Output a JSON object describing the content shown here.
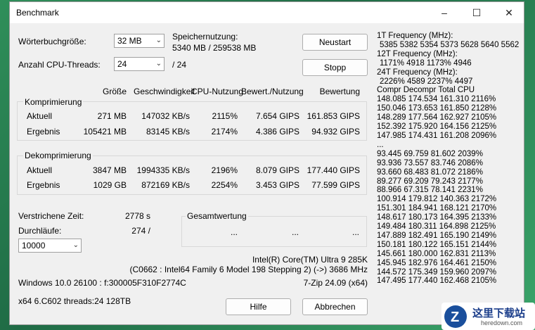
{
  "window": {
    "title": "Benchmark",
    "controls": [
      "–",
      "☐",
      "✕"
    ]
  },
  "settings": {
    "dictionary_label": "Wörterbuchgröße:",
    "dictionary_value": "32 MB",
    "threads_label": "Anzahl CPU-Threads:",
    "threads_value": "24",
    "threads_total": "/ 24",
    "memory_label": "Speichernutzung:",
    "memory_value": "5340 MB / 259538 MB"
  },
  "buttons": {
    "restart": "Neustart",
    "stop": "Stopp",
    "help": "Hilfe",
    "cancel": "Abbrechen"
  },
  "columns": [
    "Größe",
    "Geschwindigkeit",
    "CPU-Nutzung",
    "Bewert./Nutzung",
    "Bewertung"
  ],
  "compression": {
    "title": "Komprimierung",
    "rows": [
      {
        "label": "Aktuell",
        "size": "271 MB",
        "speed": "147032 KB/s",
        "cpu": "2115%",
        "rating_usage": "7.654 GIPS",
        "rating": "161.853 GIPS"
      },
      {
        "label": "Ergebnis",
        "size": "105421 MB",
        "speed": "83145 KB/s",
        "cpu": "2174%",
        "rating_usage": "4.386 GIPS",
        "rating": "94.932 GIPS"
      }
    ]
  },
  "decompression": {
    "title": "Dekomprimierung",
    "rows": [
      {
        "label": "Aktuell",
        "size": "3847 MB",
        "speed": "1994335 KB/s",
        "cpu": "2196%",
        "rating_usage": "8.079 GIPS",
        "rating": "177.440 GIPS"
      },
      {
        "label": "Ergebnis",
        "size": "1029 GB",
        "speed": "872169 KB/s",
        "cpu": "2254%",
        "rating_usage": "3.453 GIPS",
        "rating": "77.599 GIPS"
      }
    ]
  },
  "elapsed": {
    "label": "Verstrichene Zeit:",
    "value": "2778 s"
  },
  "passes": {
    "label": "Durchläufe:",
    "value": "274 /",
    "select": "10000"
  },
  "total": {
    "title": "Gesamtwertung",
    "values": [
      "...",
      "...",
      "..."
    ]
  },
  "cpu_info": {
    "name": "Intel(R) Core(TM) Ultra 9 285K",
    "detail": "(C0662 : Intel64 Family 6 Model 198 Stepping 2) (->) 3686 MHz",
    "os": "Windows 10.0 26100 : f:300005F310F2774C",
    "version": "7-Zip 24.09 (x64)",
    "arch": "x64 6.C602 threads:24 128TB"
  },
  "freq": {
    "f1_label": "1T Frequency (MHz):",
    "f1_values": "5385 5382 5354 5373 5628 5640 5562",
    "f12_label": "12T Frequency (MHz):",
    "f12_values": "1171% 4918 1173% 4946",
    "f24_label": "24T Frequency (MHz):",
    "f24_values": "2226% 4589 2237% 4497",
    "table_header": "Compr Decompr Total   CPU",
    "rows_a": [
      "148.085  174.534  161.310  2116%",
      "150.046  173.653  161.850  2128%",
      "148.289  177.564  162.927  2105%",
      "152.392  175.920  164.156  2125%",
      "147.985  174.431  161.208  2096%"
    ],
    "ellipsis": "...",
    "rows_b": [
      "93.445  69.759  81.602  2039%",
      "93.936  73.557  83.746  2086%",
      "93.660  68.483  81.072  2186%",
      "89.277  69.209  79.243  2177%",
      "88.966  67.315  78.141  2231%",
      "100.914  179.812  140.363  2172%",
      "151.301  184.941  168.121  2170%",
      "148.617  180.173  164.395  2133%",
      "149.484  180.311  164.898  2125%",
      "147.889  182.491  165.190  2149%",
      "150.181  180.122  165.151  2144%",
      "145.661  180.000  162.831  2113%",
      "145.945  182.976  164.461  2150%",
      "144.572  175.349  159.960  2097%",
      "147.495  177.440  162.468  2105%"
    ]
  },
  "watermark": {
    "text": "这里下载站",
    "sub": "heredown.com"
  }
}
